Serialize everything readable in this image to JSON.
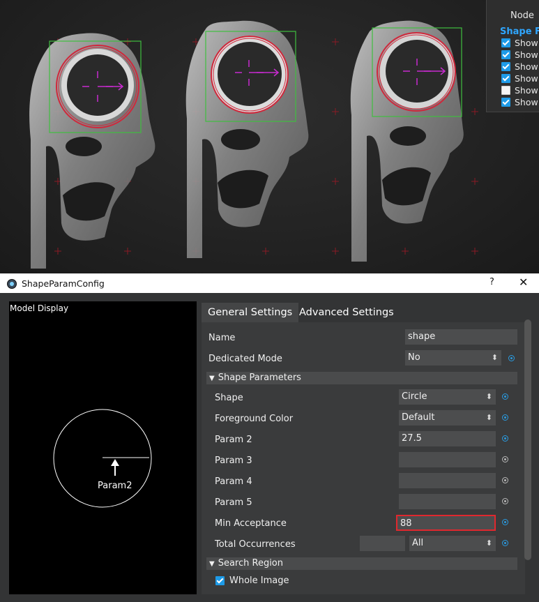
{
  "display_panel": {
    "node_label": "Node",
    "section_title": "Shape Fir",
    "checkboxes": [
      {
        "label": "Show I",
        "checked": true
      },
      {
        "label": "Show I",
        "checked": true
      },
      {
        "label": "Show I",
        "checked": true
      },
      {
        "label": "Show I",
        "checked": true
      },
      {
        "label": "Show I",
        "checked": false
      },
      {
        "label": "Show I",
        "checked": true
      }
    ]
  },
  "dialog": {
    "title": "ShapeParamConfig",
    "help_label": "?",
    "close_label": "✕",
    "model_display_label": "Model Display",
    "param_diagram_label": "Param2",
    "tabs": [
      {
        "label": "General Settings",
        "active": true
      },
      {
        "label": "Advanced Settings",
        "active": false
      }
    ],
    "fields": {
      "name": {
        "label": "Name",
        "value": "shape"
      },
      "dedicated_mode": {
        "label": "Dedicated Mode",
        "value": "No"
      },
      "shape_params_group": "Shape Parameters",
      "shape": {
        "label": "Shape",
        "value": "Circle"
      },
      "foreground_color": {
        "label": "Foreground Color",
        "value": "Default"
      },
      "param2": {
        "label": "Param 2",
        "value": "27.5"
      },
      "param3": {
        "label": "Param 3",
        "value": ""
      },
      "param4": {
        "label": "Param 4",
        "value": ""
      },
      "param5": {
        "label": "Param 5",
        "value": ""
      },
      "min_acceptance": {
        "label": "Min Acceptance",
        "value": "88"
      },
      "total_occurrences": {
        "label": "Total Occurrences",
        "value": "",
        "mode": "All"
      },
      "search_region_group": "Search Region",
      "whole_image": {
        "label": "Whole Image",
        "checked": true
      }
    }
  },
  "colors": {
    "accent": "#2a9be0",
    "highlight_border": "#e0282e",
    "match_box": "#3fbf3f",
    "match_circle": "#d0283c",
    "match_axis": "#c82bd0"
  }
}
